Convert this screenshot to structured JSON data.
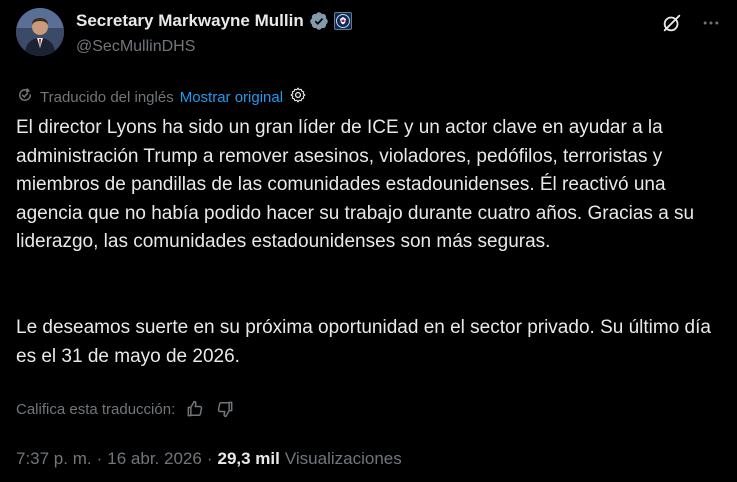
{
  "author": {
    "name": "Secretary Markwayne Mullin",
    "handle": "@SecMullinDHS"
  },
  "translation": {
    "label": "Traducido del inglés",
    "show_original": "Mostrar original"
  },
  "tweet": {
    "paragraph1": "El director Lyons ha sido un gran líder de ICE y un actor clave en ayudar a la administración Trump a remover asesinos, violadores, pedófilos, terroristas y miembros de pandillas de las comunidades estadounidenses. Él reactivó una agencia que no había podido hacer su trabajo durante cuatro años. Gracias a su liderazgo, las comunidades estadounidenses son más seguras.",
    "paragraph2": "Le deseamos suerte en su próxima oportunidad en el sector privado. Su último día es el 31 de mayo de 2026."
  },
  "rating": {
    "label": "Califica esta traducción:"
  },
  "meta": {
    "time": "7:37 p. m.",
    "separator1": "·",
    "date": "16 abr. 2026",
    "separator2": "·",
    "views_count": "29,3 mil",
    "views_label": "Visualizaciones"
  },
  "icons": {
    "verified": "verified-badge-icon",
    "agency": "dhs-seal-icon",
    "grok": "grok-icon",
    "more": "more-icon",
    "translate": "translate-icon",
    "settings": "gear-icon",
    "thumbs_up": "thumbs-up-icon",
    "thumbs_down": "thumbs-down-icon"
  },
  "colors": {
    "background": "#000000",
    "text": "#e7e9ea",
    "secondary": "#71767b",
    "link": "#1d9bf0"
  }
}
